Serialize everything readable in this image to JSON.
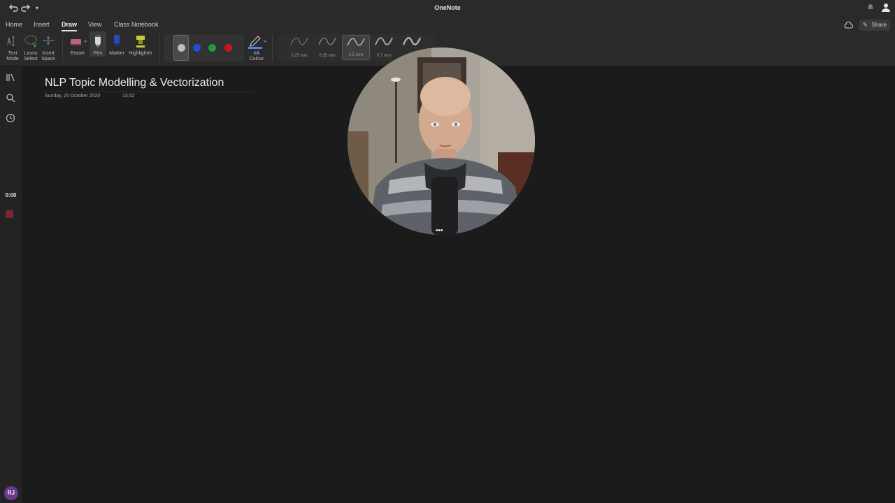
{
  "window": {
    "title": "OneNote"
  },
  "titlebar": {
    "undo_icon": "undo-icon",
    "redo_icon": "redo-icon",
    "customize_icon": "chevron-down-icon",
    "bell_icon": "bell-icon",
    "account_icon": "person-icon"
  },
  "menu": {
    "tabs": [
      {
        "label": "Home"
      },
      {
        "label": "Insert"
      },
      {
        "label": "Draw"
      },
      {
        "label": "View"
      },
      {
        "label": "Class Notebook"
      }
    ],
    "active_tab": "Draw",
    "share_label": "Share"
  },
  "ribbon": {
    "tools": [
      {
        "label1": "Text",
        "label2": "Mode"
      },
      {
        "label1": "Lasso",
        "label2": "Select"
      },
      {
        "label1": "Insert",
        "label2": "Space"
      }
    ],
    "eraser_label": "Eraser",
    "pen_label": "Pen",
    "marker_label": "Marker",
    "highlighter_label": "Highlighter",
    "pen_colors": [
      "#bdbdbd",
      "#1f4fd6",
      "#1f9a3c",
      "#c8141e"
    ],
    "ink_colour_label1": "Ink",
    "ink_colour_label2": "Colour",
    "thicknesses": [
      {
        "label": "0.25 mm"
      },
      {
        "label": "0.35 mm"
      },
      {
        "label": "0.5 mm"
      },
      {
        "label": "0.7 mm"
      },
      {
        "label": ""
      }
    ],
    "selected_thickness": "0.5 mm"
  },
  "rail": {
    "timer": "0:00",
    "avatar_initials": "RJ"
  },
  "page": {
    "title": "NLP Topic Modelling & Vectorization",
    "date": "Sunday, 25 October 2020",
    "time": "13.52"
  },
  "webcam": {
    "more_label": "•••"
  },
  "colors": {
    "background": "#1b1b1b",
    "chrome": "#2a2a2a",
    "avatar": "#6b3a8c",
    "record": "#7a2730"
  }
}
